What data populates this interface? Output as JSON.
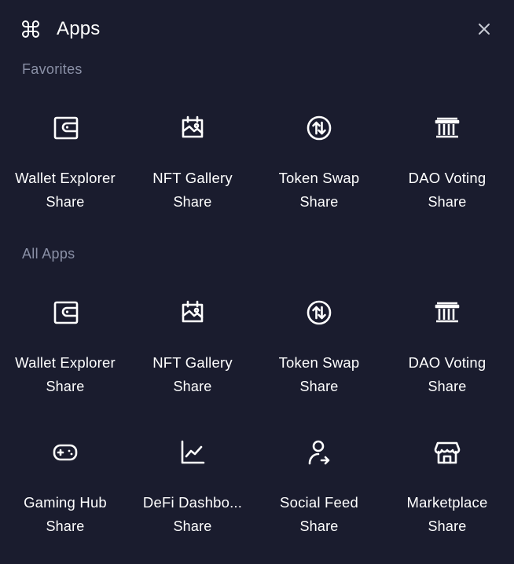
{
  "header": {
    "title": "Apps",
    "icon": "command-icon",
    "close_icon": "close-icon"
  },
  "sections": {
    "favorites_label": "Favorites",
    "all_apps_label": "All Apps"
  },
  "colors": {
    "background": "#1a1c2e",
    "text": "#ffffff",
    "muted": "#8a90a6"
  },
  "favorites": [
    {
      "name": "Wallet Explorer",
      "action": "Share",
      "icon": "wallet-icon"
    },
    {
      "name": "NFT Gallery",
      "action": "Share",
      "icon": "gallery-icon"
    },
    {
      "name": "Token Swap",
      "action": "Share",
      "icon": "swap-icon"
    },
    {
      "name": "DAO Voting",
      "action": "Share",
      "icon": "bank-icon"
    }
  ],
  "all_apps": [
    {
      "name": "Wallet Explorer",
      "action": "Share",
      "icon": "wallet-icon"
    },
    {
      "name": "NFT Gallery",
      "action": "Share",
      "icon": "gallery-icon"
    },
    {
      "name": "Token Swap",
      "action": "Share",
      "icon": "swap-icon"
    },
    {
      "name": "DAO Voting",
      "action": "Share",
      "icon": "bank-icon"
    },
    {
      "name": "Gaming Hub",
      "action": "Share",
      "icon": "gamepad-icon"
    },
    {
      "name": "DeFi Dashbo...",
      "action": "Share",
      "icon": "line-chart-icon"
    },
    {
      "name": "Social Feed",
      "action": "Share",
      "icon": "user-share-icon"
    },
    {
      "name": "Marketplace",
      "action": "Share",
      "icon": "store-icon"
    }
  ]
}
